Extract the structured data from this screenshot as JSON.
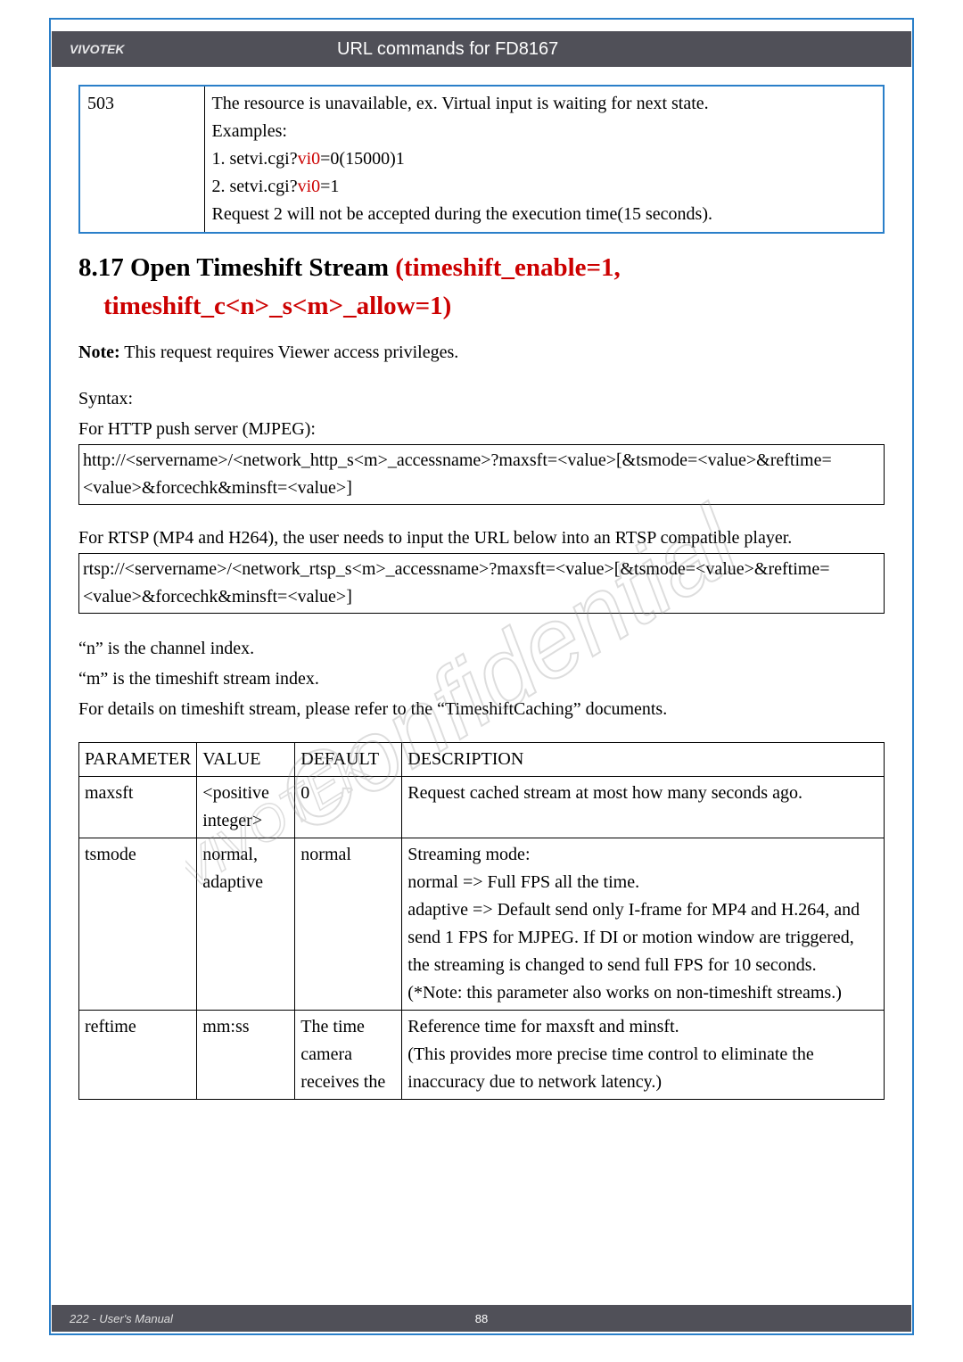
{
  "header": {
    "brand": "VIVOTEK",
    "title": "URL commands for FD8167"
  },
  "footer": {
    "left": "222 - User's Manual",
    "page": "88"
  },
  "top_table": {
    "code": "503",
    "line1": "The resource is unavailable, ex. Virtual input is waiting for next state.",
    "line2": "Examples:",
    "line3a": "1. setvi.cgi?",
    "line3b": "vi0",
    "line3c": "=0(15000)1",
    "line4a": "2. setvi.cgi?",
    "line4b": "vi0",
    "line4c": "=1",
    "line5": "Request 2 will not be accepted during the execution time(15 seconds)."
  },
  "section": {
    "title_prefix": "8.17 Open Timeshift Stream ",
    "title_red": "(timeshift_enable=1,",
    "subtitle_red": "timeshift_c<n>_s<m>_allow=1)",
    "note_label": "Note:",
    "note_text": " This request requires Viewer access privileges.",
    "syntax_label": "Syntax:",
    "http_push": "For HTTP push server (MJPEG):",
    "http_syntax": "http://<servername>/<network_http_s<m>_accessname>?maxsft=<value>[&tsmode=<value>&reftime=<value>&forcechk&minsft=<value>]",
    "rtsp_intro": "For RTSP (MP4 and H264), the user needs to input the URL below into an RTSP compatible player.",
    "rtsp_syntax": "rtsp://<servername>/<network_rtsp_s<m>_accessname>?maxsft=<value>[&tsmode=<value>&reftime=<value>&forcechk&minsft=<value>]",
    "n_index": "“n” is the channel index.",
    "m_index": "“m” is the timeshift stream index.",
    "details": "For details on timeshift stream, please refer to the “TimeshiftCaching” documents."
  },
  "param_table": {
    "headers": [
      "PARAMETER",
      "VALUE",
      "DEFAULT",
      "DESCRIPTION"
    ],
    "rows": [
      {
        "param": "maxsft",
        "value": "<positive integer>",
        "default": "0",
        "desc": "Request cached stream at most how many seconds ago."
      },
      {
        "param": "tsmode",
        "value": "normal, adaptive",
        "default": "normal",
        "desc": "Streaming mode:\nnormal => Full FPS all the time.\nadaptive => Default send only I-frame for MP4 and H.264, and send 1 FPS for MJPEG. If DI or motion window are triggered, the streaming is changed to send full FPS for 10 seconds.\n(*Note: this parameter also works on non-timeshift streams.)"
      },
      {
        "param": "reftime",
        "value": "mm:ss",
        "default": "The time camera receives the",
        "desc": "Reference time for maxsft and minsft.\n(This provides more precise time control to eliminate the inaccuracy due to network latency.)"
      }
    ]
  }
}
